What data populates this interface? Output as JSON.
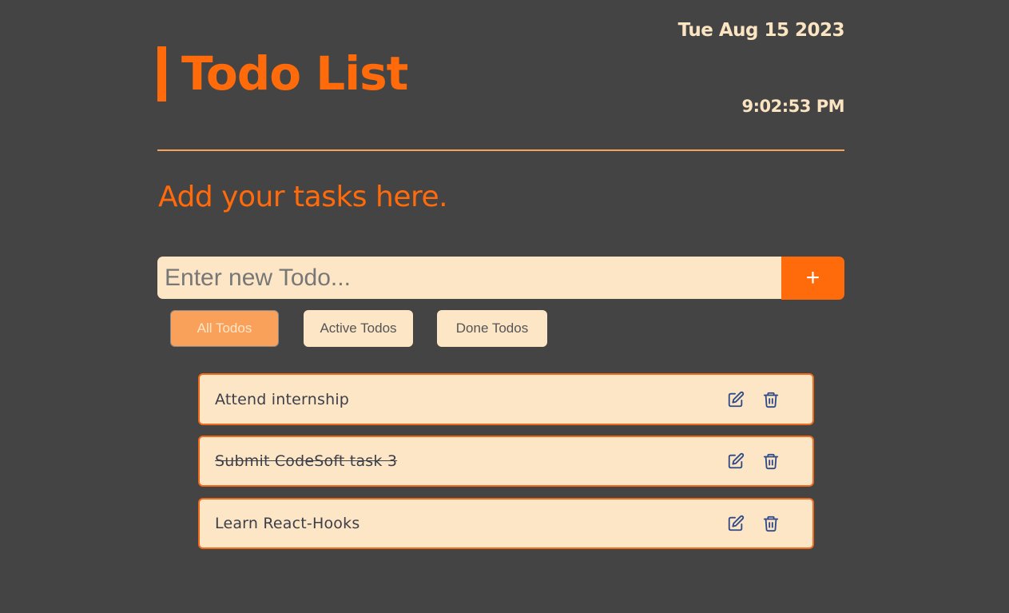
{
  "header": {
    "title": "Todo List",
    "date": "Tue Aug 15 2023",
    "time": "9:02:53 PM"
  },
  "subtitle": "Add your tasks here.",
  "new_todo": {
    "placeholder": "Enter new Todo...",
    "value": "",
    "add_label": "+"
  },
  "filters": {
    "all_label": "All Todos",
    "active_label": "Active Todos",
    "done_label": "Done Todos",
    "selected": "All Todos"
  },
  "todos": [
    {
      "text": "Attend internship",
      "done": false,
      "edit_icon": "edit-icon",
      "delete_icon": "trash-icon"
    },
    {
      "text": "Submit CodeSoft task 3",
      "done": true,
      "edit_icon": "edit-icon",
      "delete_icon": "trash-icon"
    },
    {
      "text": "Learn React-Hooks",
      "done": false,
      "edit_icon": "edit-icon",
      "delete_icon": "trash-icon"
    }
  ],
  "colors": {
    "background": "#444444",
    "accent": "#ff6a0a",
    "cream": "#fde6c6",
    "active_filter": "#f9a15a",
    "icon": "#2f4a87"
  }
}
